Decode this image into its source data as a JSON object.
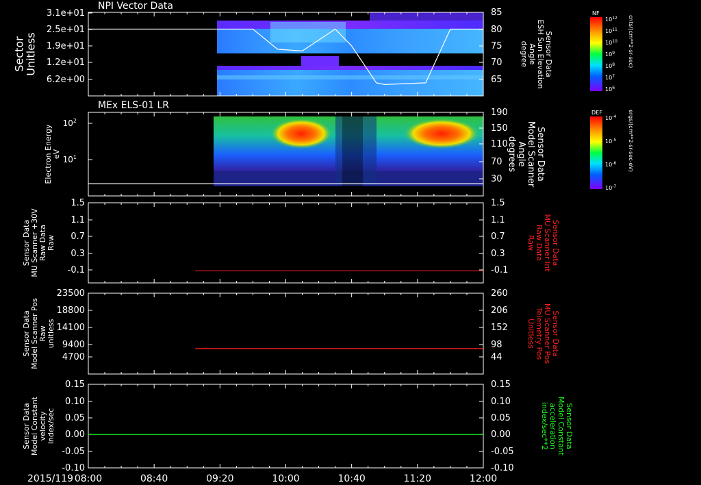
{
  "time_axis": {
    "date": "2015/119",
    "ticks": [
      "08:00",
      "08:40",
      "09:20",
      "10:00",
      "10:40",
      "11:20",
      "12:00"
    ],
    "range": [
      "08:00",
      "12:00"
    ]
  },
  "panels": [
    {
      "id": "npi",
      "title": "NPI Vector Data",
      "left_label": [
        "Sector",
        "Unitless"
      ],
      "left_ticks": [
        "3.1e+01",
        "2.5e+01",
        "1.9e+01",
        "1.2e+01",
        "6.2e+00"
      ],
      "right_label": [
        "Sensor Data",
        "ESH Sun Elevation",
        "Angle",
        "degree"
      ],
      "right_ticks": [
        "85",
        "80",
        "75",
        "70",
        "65"
      ],
      "colorbar": {
        "title": "NF",
        "unit": "cnts/(cm**2-sr-sec)",
        "ticks": [
          "10^12",
          "10^11",
          "10^10",
          "10^9",
          "10^8",
          "10^7",
          "10^6"
        ]
      }
    },
    {
      "id": "els",
      "title": "MEx ELS-01 LR",
      "left_label": [
        "Electron Energy",
        "eV"
      ],
      "left_ticks": [
        "10^2",
        "10^1"
      ],
      "right_label": [
        "Sensor Data",
        "Model Scanner",
        "Angle",
        "degrees"
      ],
      "right_ticks": [
        "190",
        "150",
        "110",
        "70",
        "30"
      ],
      "colorbar": {
        "title": "DEF",
        "unit": "ergs/(cm**2-sr-sec-eV)",
        "ticks": [
          "10^-4",
          "10^-5",
          "10^-6",
          "10^-7"
        ]
      }
    },
    {
      "id": "mu30",
      "left_label": [
        "Sensor Data",
        "MU Scanner +30V",
        "Raw Data",
        "Raw"
      ],
      "left_ticks": [
        "1.5",
        "1.1",
        "0.7",
        "0.3",
        "-0.1"
      ],
      "right_label": [
        "Sensor Data",
        "MU Scanner Int",
        "Raw Data",
        "Raw"
      ],
      "right_ticks": [
        "1.5",
        "1.1",
        "0.7",
        "0.3",
        "-0.1"
      ]
    },
    {
      "id": "mupos",
      "left_label": [
        "Sensor Data",
        "Model Scanner Pos",
        "Raw",
        "unitless"
      ],
      "left_ticks": [
        "23500",
        "18800",
        "14100",
        "9400",
        "4700"
      ],
      "right_label": [
        "Sensor Data",
        "MU Scanner Pos",
        "Telemetry Pos",
        "Unitless"
      ],
      "right_ticks": [
        "260",
        "206",
        "152",
        "98",
        "44"
      ]
    },
    {
      "id": "model",
      "left_label": [
        "Sensor Data",
        "Model Constant",
        "velocity",
        "index/sec"
      ],
      "left_ticks": [
        "0.15",
        "0.10",
        "0.05",
        "0.00",
        "-0.05",
        "-0.10"
      ],
      "right_label": [
        "Sensor Data",
        "Model Constant",
        "acceleration",
        "index/sec**2"
      ],
      "right_ticks": [
        "0.15",
        "0.10",
        "0.05",
        "0.00",
        "-0.05",
        "-0.10"
      ]
    }
  ],
  "colors": {
    "trace_white": "#ffffff",
    "trace_red": "#ff2020",
    "trace_green": "#20ff20",
    "label_red": "#ff2020",
    "label_green": "#20ff20"
  },
  "chart_data": [
    {
      "type": "heatmap",
      "title": "NPI Vector Data",
      "ylabel": "Sector Unitless",
      "y2label": "Sensor Data ESH Sun Elevation Angle degree",
      "data_start": "09:10",
      "line_series": {
        "x": [
          "08:00",
          "09:30",
          "09:40",
          "09:55",
          "10:10",
          "10:30",
          "10:40",
          "10:55",
          "11:00",
          "11:25",
          "11:40",
          "12:00"
        ],
        "y": [
          80,
          80,
          80,
          74,
          73.5,
          80,
          75,
          64,
          63.5,
          64,
          80,
          80
        ]
      }
    },
    {
      "type": "heatmap",
      "title": "MEx ELS-01 LR",
      "ylabel": "Electron Energy eV",
      "y2label": "Sensor Data Model Scanner Angle degrees",
      "yscale": "log",
      "data_start": "09:08",
      "line_series": {
        "x": [
          "08:00",
          "12:00"
        ],
        "y": [
          18,
          18
        ]
      }
    },
    {
      "type": "line",
      "ylabel": "Sensor Data MU Scanner +30V Raw Data Raw",
      "y2label": "Sensor Data MU Scanner Int Raw Data Raw",
      "ylim": [
        -0.3,
        1.5
      ],
      "series": [
        {
          "x": [
            "09:05",
            "12:00"
          ],
          "y": [
            -0.03,
            -0.03
          ]
        }
      ]
    },
    {
      "type": "line",
      "ylabel": "Sensor Data Model Scanner Pos Raw unitless",
      "y2label": "Sensor Data MU Scanner Pos Telemetry Pos Unitless",
      "ylim": [
        0,
        23500
      ],
      "series": [
        {
          "x": [
            "09:05",
            "12:00"
          ],
          "y": [
            7400,
            7400
          ]
        }
      ]
    },
    {
      "type": "line",
      "ylabel": "Sensor Data Model Constant velocity index/sec",
      "y2label": "Sensor Data Model Constant acceleration index/sec**2",
      "ylim": [
        -0.1,
        0.15
      ],
      "series": [
        {
          "x": [
            "08:00",
            "12:00"
          ],
          "y": [
            0.0,
            0.0
          ]
        }
      ]
    }
  ]
}
